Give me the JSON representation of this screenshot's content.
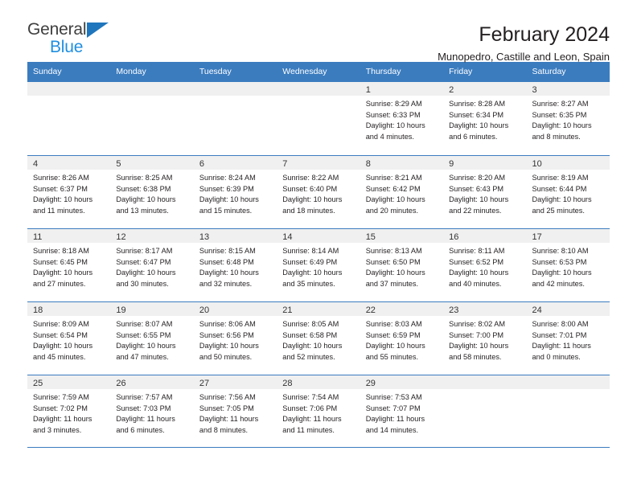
{
  "brand": {
    "name_top": "General",
    "name_bottom": "Blue",
    "accent_dark": "#3f3f3f",
    "accent_blue": "#1f8fe0",
    "triangle_color": "#1f76bc"
  },
  "header": {
    "title": "February 2024",
    "subtitle": "Munopedro, Castille and Leon, Spain"
  },
  "calendar": {
    "header_bg": "#3b7cbf",
    "daynum_bg": "#f0f0f0",
    "weekdays": [
      "Sunday",
      "Monday",
      "Tuesday",
      "Wednesday",
      "Thursday",
      "Friday",
      "Saturday"
    ],
    "weeks": [
      [
        {
          "day": "",
          "lines": []
        },
        {
          "day": "",
          "lines": []
        },
        {
          "day": "",
          "lines": []
        },
        {
          "day": "",
          "lines": []
        },
        {
          "day": "1",
          "lines": [
            "Sunrise: 8:29 AM",
            "Sunset: 6:33 PM",
            "Daylight: 10 hours",
            "and 4 minutes."
          ]
        },
        {
          "day": "2",
          "lines": [
            "Sunrise: 8:28 AM",
            "Sunset: 6:34 PM",
            "Daylight: 10 hours",
            "and 6 minutes."
          ]
        },
        {
          "day": "3",
          "lines": [
            "Sunrise: 8:27 AM",
            "Sunset: 6:35 PM",
            "Daylight: 10 hours",
            "and 8 minutes."
          ]
        }
      ],
      [
        {
          "day": "4",
          "lines": [
            "Sunrise: 8:26 AM",
            "Sunset: 6:37 PM",
            "Daylight: 10 hours",
            "and 11 minutes."
          ]
        },
        {
          "day": "5",
          "lines": [
            "Sunrise: 8:25 AM",
            "Sunset: 6:38 PM",
            "Daylight: 10 hours",
            "and 13 minutes."
          ]
        },
        {
          "day": "6",
          "lines": [
            "Sunrise: 8:24 AM",
            "Sunset: 6:39 PM",
            "Daylight: 10 hours",
            "and 15 minutes."
          ]
        },
        {
          "day": "7",
          "lines": [
            "Sunrise: 8:22 AM",
            "Sunset: 6:40 PM",
            "Daylight: 10 hours",
            "and 18 minutes."
          ]
        },
        {
          "day": "8",
          "lines": [
            "Sunrise: 8:21 AM",
            "Sunset: 6:42 PM",
            "Daylight: 10 hours",
            "and 20 minutes."
          ]
        },
        {
          "day": "9",
          "lines": [
            "Sunrise: 8:20 AM",
            "Sunset: 6:43 PM",
            "Daylight: 10 hours",
            "and 22 minutes."
          ]
        },
        {
          "day": "10",
          "lines": [
            "Sunrise: 8:19 AM",
            "Sunset: 6:44 PM",
            "Daylight: 10 hours",
            "and 25 minutes."
          ]
        }
      ],
      [
        {
          "day": "11",
          "lines": [
            "Sunrise: 8:18 AM",
            "Sunset: 6:45 PM",
            "Daylight: 10 hours",
            "and 27 minutes."
          ]
        },
        {
          "day": "12",
          "lines": [
            "Sunrise: 8:17 AM",
            "Sunset: 6:47 PM",
            "Daylight: 10 hours",
            "and 30 minutes."
          ]
        },
        {
          "day": "13",
          "lines": [
            "Sunrise: 8:15 AM",
            "Sunset: 6:48 PM",
            "Daylight: 10 hours",
            "and 32 minutes."
          ]
        },
        {
          "day": "14",
          "lines": [
            "Sunrise: 8:14 AM",
            "Sunset: 6:49 PM",
            "Daylight: 10 hours",
            "and 35 minutes."
          ]
        },
        {
          "day": "15",
          "lines": [
            "Sunrise: 8:13 AM",
            "Sunset: 6:50 PM",
            "Daylight: 10 hours",
            "and 37 minutes."
          ]
        },
        {
          "day": "16",
          "lines": [
            "Sunrise: 8:11 AM",
            "Sunset: 6:52 PM",
            "Daylight: 10 hours",
            "and 40 minutes."
          ]
        },
        {
          "day": "17",
          "lines": [
            "Sunrise: 8:10 AM",
            "Sunset: 6:53 PM",
            "Daylight: 10 hours",
            "and 42 minutes."
          ]
        }
      ],
      [
        {
          "day": "18",
          "lines": [
            "Sunrise: 8:09 AM",
            "Sunset: 6:54 PM",
            "Daylight: 10 hours",
            "and 45 minutes."
          ]
        },
        {
          "day": "19",
          "lines": [
            "Sunrise: 8:07 AM",
            "Sunset: 6:55 PM",
            "Daylight: 10 hours",
            "and 47 minutes."
          ]
        },
        {
          "day": "20",
          "lines": [
            "Sunrise: 8:06 AM",
            "Sunset: 6:56 PM",
            "Daylight: 10 hours",
            "and 50 minutes."
          ]
        },
        {
          "day": "21",
          "lines": [
            "Sunrise: 8:05 AM",
            "Sunset: 6:58 PM",
            "Daylight: 10 hours",
            "and 52 minutes."
          ]
        },
        {
          "day": "22",
          "lines": [
            "Sunrise: 8:03 AM",
            "Sunset: 6:59 PM",
            "Daylight: 10 hours",
            "and 55 minutes."
          ]
        },
        {
          "day": "23",
          "lines": [
            "Sunrise: 8:02 AM",
            "Sunset: 7:00 PM",
            "Daylight: 10 hours",
            "and 58 minutes."
          ]
        },
        {
          "day": "24",
          "lines": [
            "Sunrise: 8:00 AM",
            "Sunset: 7:01 PM",
            "Daylight: 11 hours",
            "and 0 minutes."
          ]
        }
      ],
      [
        {
          "day": "25",
          "lines": [
            "Sunrise: 7:59 AM",
            "Sunset: 7:02 PM",
            "Daylight: 11 hours",
            "and 3 minutes."
          ]
        },
        {
          "day": "26",
          "lines": [
            "Sunrise: 7:57 AM",
            "Sunset: 7:03 PM",
            "Daylight: 11 hours",
            "and 6 minutes."
          ]
        },
        {
          "day": "27",
          "lines": [
            "Sunrise: 7:56 AM",
            "Sunset: 7:05 PM",
            "Daylight: 11 hours",
            "and 8 minutes."
          ]
        },
        {
          "day": "28",
          "lines": [
            "Sunrise: 7:54 AM",
            "Sunset: 7:06 PM",
            "Daylight: 11 hours",
            "and 11 minutes."
          ]
        },
        {
          "day": "29",
          "lines": [
            "Sunrise: 7:53 AM",
            "Sunset: 7:07 PM",
            "Daylight: 11 hours",
            "and 14 minutes."
          ]
        },
        {
          "day": "",
          "lines": []
        },
        {
          "day": "",
          "lines": []
        }
      ]
    ]
  }
}
